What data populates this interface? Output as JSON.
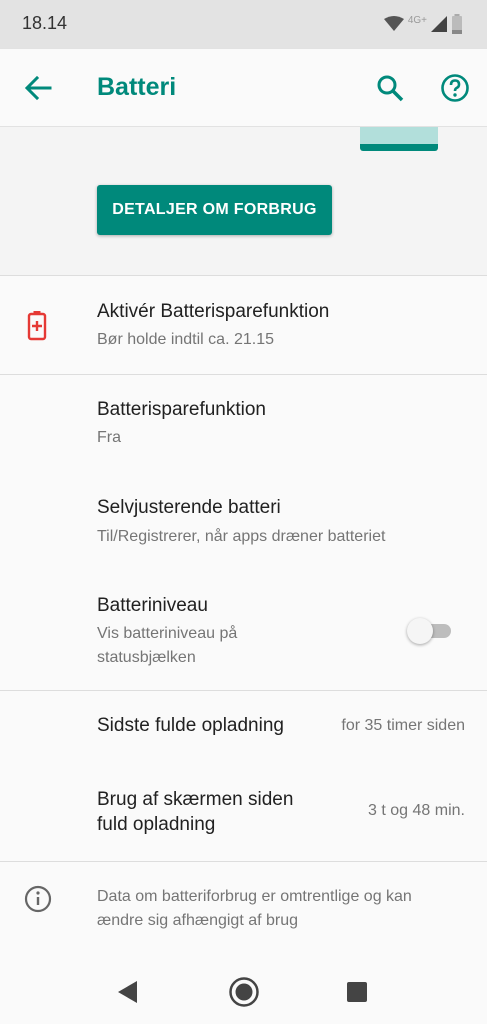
{
  "status_bar": {
    "time": "18.14",
    "network_label": "4G+",
    "icons": [
      "wifi-icon",
      "cell-signal-icon",
      "battery-low-icon"
    ]
  },
  "app_bar": {
    "title": "Batteri",
    "icons": [
      "back-arrow-icon",
      "search-icon",
      "help-icon"
    ]
  },
  "graph": {
    "details_button_label": "DETALJER OM FORBRUG"
  },
  "battery_saver_suggestion": {
    "title": "Aktivér Batterisparefunktion",
    "subtitle": "Bør holde indtil ca. 21.15",
    "icon": "battery-alert-icon"
  },
  "settings": {
    "battery_saver": {
      "title": "Batterisparefunktion",
      "subtitle": "Fra"
    },
    "adaptive_battery": {
      "title": "Selvjusterende batteri",
      "subtitle": "Til/Registrerer, når apps dræner batteriet"
    },
    "battery_level": {
      "title": "Batteriniveau",
      "subtitle_line1": "Vis batteriniveau på",
      "subtitle_line2": "statusbjælken",
      "toggle_on": false
    }
  },
  "usage": {
    "last_full_charge": {
      "title": "Sidste fulde opladning",
      "value": "for 35 timer siden"
    },
    "screen_usage": {
      "title_line1": "Brug af skærmen siden",
      "title_line2": "fuld opladning",
      "value": "3 t og 48 min."
    }
  },
  "footer_info": {
    "text": "Data om batteriforbrug er omtrentlige og kan ændre sig afhængigt af brug",
    "icon": "info-icon"
  },
  "navigation_bar": {
    "icons": [
      "nav-back-icon",
      "nav-home-icon",
      "nav-recents-icon"
    ]
  },
  "colors": {
    "accent": "#00897b",
    "accent_light": "#b2dfdb",
    "alert_red": "#e53935"
  }
}
